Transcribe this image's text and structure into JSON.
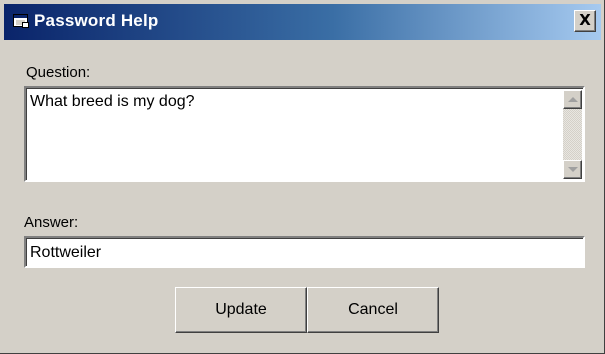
{
  "window": {
    "title": "Password Help",
    "close_glyph": "X",
    "icon": "app-window-icon"
  },
  "form": {
    "question_label": "Question:",
    "question_value": "What breed is my dog?",
    "answer_label": "Answer:",
    "answer_value": "Rottweiler"
  },
  "buttons": {
    "update_label": "Update",
    "cancel_label": "Cancel"
  },
  "colors": {
    "title_bar_start": "#0a246a",
    "title_bar_end": "#a6caf0",
    "face": "#d4d0c8"
  }
}
